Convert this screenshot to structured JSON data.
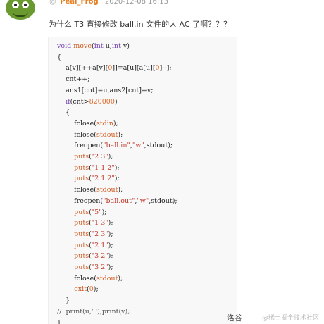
{
  "post": {
    "at_symbol": "@",
    "username": "Peal_Frog",
    "timestamp": "2020-12-08 16:13",
    "question": "为什么 T3 直接修改 ball.in 文件的人 AC 了啊？？？"
  },
  "code_lines": [
    [
      {
        "c": "kw",
        "t": "void"
      },
      {
        "c": "",
        "t": " "
      },
      {
        "c": "fn",
        "t": "move"
      },
      {
        "c": "",
        "t": "("
      },
      {
        "c": "kw",
        "t": "int"
      },
      {
        "c": "",
        "t": " u,"
      },
      {
        "c": "kw",
        "t": "int"
      },
      {
        "c": "",
        "t": " v)"
      }
    ],
    [
      {
        "c": "",
        "t": "{"
      }
    ],
    [
      {
        "c": "",
        "t": "    a[v][++a[v]["
      },
      {
        "c": "num",
        "t": "0"
      },
      {
        "c": "",
        "t": "]]=a[u][a[u]["
      },
      {
        "c": "num",
        "t": "0"
      },
      {
        "c": "",
        "t": "]--];"
      }
    ],
    [
      {
        "c": "",
        "t": "    cnt++;"
      }
    ],
    [
      {
        "c": "",
        "t": "    ans1[cnt]=u,ans2[cnt]=v;"
      }
    ],
    [
      {
        "c": "",
        "t": "    "
      },
      {
        "c": "kw",
        "t": "if"
      },
      {
        "c": "",
        "t": "(cnt>"
      },
      {
        "c": "num",
        "t": "820000"
      },
      {
        "c": "",
        "t": ")"
      }
    ],
    [
      {
        "c": "",
        "t": "    {"
      }
    ],
    [
      {
        "c": "",
        "t": "        fclose("
      },
      {
        "c": "fn",
        "t": "stdin"
      },
      {
        "c": "",
        "t": ");"
      }
    ],
    [
      {
        "c": "",
        "t": "        fclose("
      },
      {
        "c": "fn",
        "t": "stdout"
      },
      {
        "c": "",
        "t": ");"
      }
    ],
    [
      {
        "c": "",
        "t": "        freopen("
      },
      {
        "c": "str",
        "t": "\"ball.in\""
      },
      {
        "c": "",
        "t": ","
      },
      {
        "c": "str",
        "t": "\"w\""
      },
      {
        "c": "",
        "t": ",stdout);"
      }
    ],
    [
      {
        "c": "",
        "t": "        "
      },
      {
        "c": "fn",
        "t": "puts"
      },
      {
        "c": "",
        "t": "("
      },
      {
        "c": "str",
        "t": "\"2 3\""
      },
      {
        "c": "",
        "t": ");"
      }
    ],
    [
      {
        "c": "",
        "t": "        "
      },
      {
        "c": "fn",
        "t": "puts"
      },
      {
        "c": "",
        "t": "("
      },
      {
        "c": "str",
        "t": "\"1 1 2\""
      },
      {
        "c": "",
        "t": ");"
      }
    ],
    [
      {
        "c": "",
        "t": "        "
      },
      {
        "c": "fn",
        "t": "puts"
      },
      {
        "c": "",
        "t": "("
      },
      {
        "c": "str",
        "t": "\"2 1 2\""
      },
      {
        "c": "",
        "t": ");"
      }
    ],
    [
      {
        "c": "",
        "t": "        fclose("
      },
      {
        "c": "fn",
        "t": "stdout"
      },
      {
        "c": "",
        "t": ");"
      }
    ],
    [
      {
        "c": "",
        "t": "        freopen("
      },
      {
        "c": "str",
        "t": "\"ball.out\""
      },
      {
        "c": "",
        "t": ","
      },
      {
        "c": "str",
        "t": "\"w\""
      },
      {
        "c": "",
        "t": ",stdout);"
      }
    ],
    [
      {
        "c": "",
        "t": "        "
      },
      {
        "c": "fn",
        "t": "puts"
      },
      {
        "c": "",
        "t": "("
      },
      {
        "c": "str",
        "t": "\"5\""
      },
      {
        "c": "",
        "t": ");"
      }
    ],
    [
      {
        "c": "",
        "t": "        "
      },
      {
        "c": "fn",
        "t": "puts"
      },
      {
        "c": "",
        "t": "("
      },
      {
        "c": "str",
        "t": "\"1 3\""
      },
      {
        "c": "",
        "t": ");"
      }
    ],
    [
      {
        "c": "",
        "t": "        "
      },
      {
        "c": "fn",
        "t": "puts"
      },
      {
        "c": "",
        "t": "("
      },
      {
        "c": "str",
        "t": "\"2 3\""
      },
      {
        "c": "",
        "t": ");"
      }
    ],
    [
      {
        "c": "",
        "t": "        "
      },
      {
        "c": "fn",
        "t": "puts"
      },
      {
        "c": "",
        "t": "("
      },
      {
        "c": "str",
        "t": "\"2 1\""
      },
      {
        "c": "",
        "t": ");"
      }
    ],
    [
      {
        "c": "",
        "t": "        "
      },
      {
        "c": "fn",
        "t": "puts"
      },
      {
        "c": "",
        "t": "("
      },
      {
        "c": "str",
        "t": "\"3 2\""
      },
      {
        "c": "",
        "t": ");"
      }
    ],
    [
      {
        "c": "",
        "t": "        "
      },
      {
        "c": "fn",
        "t": "puts"
      },
      {
        "c": "",
        "t": "("
      },
      {
        "c": "str",
        "t": "\"3 2\""
      },
      {
        "c": "",
        "t": ");"
      }
    ],
    [
      {
        "c": "",
        "t": "        fclose("
      },
      {
        "c": "fn",
        "t": "stdout"
      },
      {
        "c": "",
        "t": ");"
      }
    ],
    [
      {
        "c": "",
        "t": "        "
      },
      {
        "c": "fn",
        "t": "exit"
      },
      {
        "c": "",
        "t": "("
      },
      {
        "c": "num",
        "t": "0"
      },
      {
        "c": "",
        "t": ");"
      }
    ],
    [
      {
        "c": "",
        "t": "    }"
      }
    ],
    [
      {
        "c": "cm",
        "t": "//  print(u,' '),print(v);"
      }
    ],
    [
      {
        "c": "",
        "t": "}"
      }
    ]
  ],
  "footer": {
    "label": "洛谷",
    "watermark": "@稀土掘金技术社区"
  },
  "colors": {
    "username": "#e67e22",
    "keyword": "#7a4bb7",
    "number": "#e06c2c",
    "string": "#c0392b",
    "function": "#cf5a1f",
    "code_background": "#f8f8f8"
  }
}
